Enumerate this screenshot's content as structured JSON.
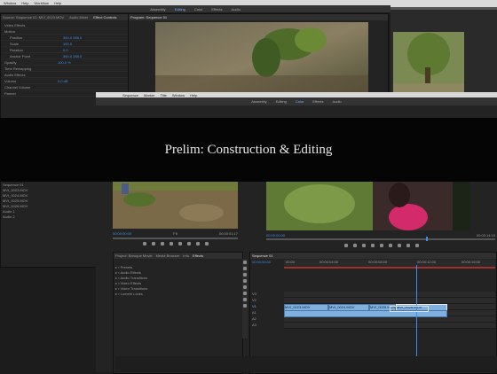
{
  "back_window": {
    "menu": [
      "Window",
      "Help",
      "Workflow",
      "Help"
    ],
    "tabs": [
      "Source: Sequence 01: MVI_0023.MOV",
      "Audio Mixer",
      "Effect Controls",
      "Metadata"
    ],
    "active_tab": "Effect Controls",
    "program_tab": "Program: Sequence 01",
    "workspaces": [
      "Assembly",
      "Editing",
      "Color",
      "Effects",
      "Audio"
    ],
    "active_workspace": "Editing",
    "effect_rows": [
      "Video Effects",
      "Motion",
      "Position",
      "Scale",
      "Rotation",
      "Anchor Point",
      "Opacity",
      "Time Remapping",
      "Audio Effects",
      "Volume",
      "Channel Volume",
      "Panner"
    ],
    "effect_values": [
      "360.0  288.0",
      "100.0",
      "0.0",
      "360.0  288.0",
      "100.0 %",
      "",
      "",
      "",
      "0.0 dB",
      "",
      "",
      ""
    ]
  },
  "front_window": {
    "menu": [
      "Sequence",
      "Marker",
      "Title",
      "Window",
      "Help"
    ],
    "workspaces": [
      "Assembly",
      "Editing",
      "Color",
      "Effects",
      "Audio"
    ],
    "active_workspace": "Color",
    "source_timecode": "00:00:00:00",
    "source_duration": "00:00:01:17",
    "program_timecode": "00:00:00:00",
    "program_duration": "00:00:14:19",
    "zoom": "Fit",
    "project_tabs": [
      "Project: Baroque Movie",
      "Media Browser",
      "Info",
      "Effects",
      "Markers",
      "History"
    ],
    "active_project_tab": "Effects",
    "effects_folders": [
      "Presets",
      "Audio Effects",
      "Audio Transitions",
      "Video Effects",
      "Video Transitions",
      "Lumetri Looks"
    ],
    "timeline_tab": "Sequence 01",
    "timeline_timecode": "00:00:00:00",
    "ruler_labels": [
      "00:00",
      "00:00:04:00",
      "00:00:08:00",
      "00:00:12:00",
      "00:00:16:00"
    ],
    "video_tracks": [
      "V3",
      "V2",
      "V1"
    ],
    "audio_tracks": [
      "A1",
      "A2",
      "A3"
    ],
    "clip_labels": [
      "MVI_0023.MOV",
      "MVI_0024.MOV",
      "MVI_0025.MOV",
      "MVI_0026.MOV"
    ]
  },
  "left_panel_rows": [
    "Sequence 01",
    "MVI_0023.MOV",
    "MVI_0024.MOV",
    "MVI_0025.MOV",
    "MVI_0026.MOV",
    "Audio 1",
    "Audio 2"
  ],
  "banner": {
    "title": "Prelim: Construction & Editing"
  },
  "colors": {
    "accent_blue": "#3d8ee8",
    "clip_blue": "#7fb0e0",
    "playhead": "#9b3cff",
    "banner_bg": "#050505"
  }
}
